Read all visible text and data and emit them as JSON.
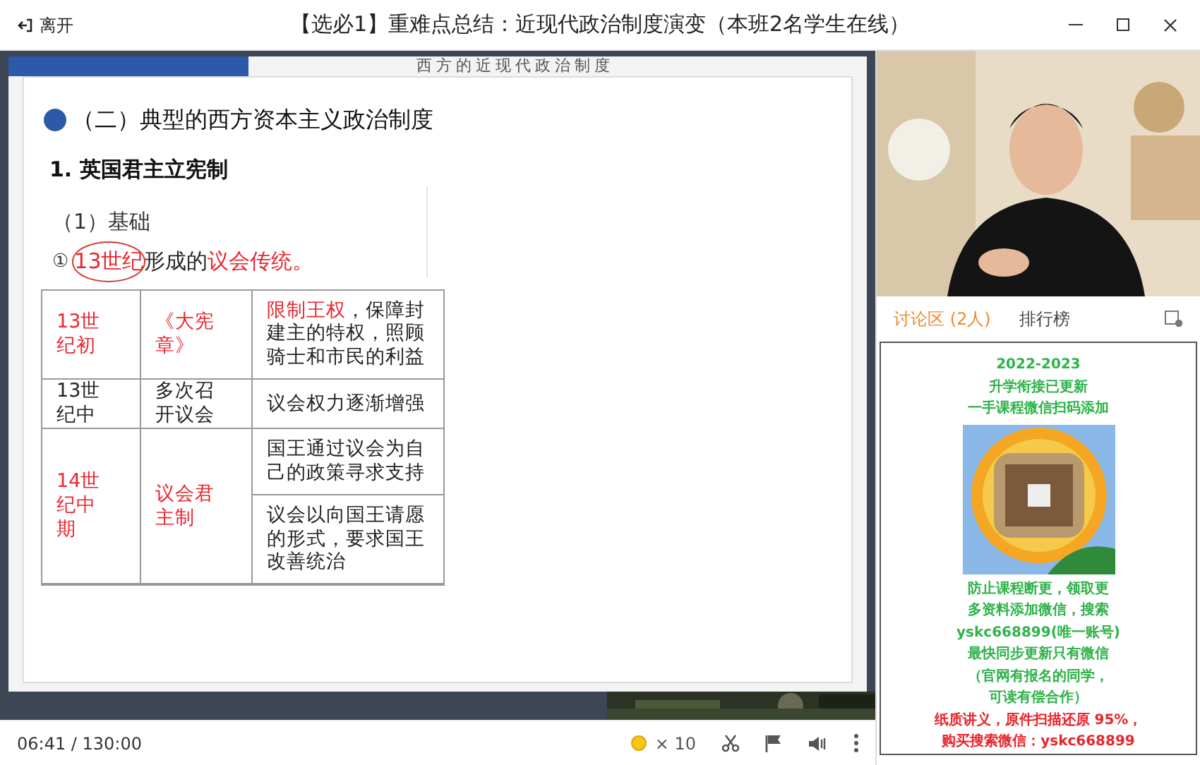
{
  "title_bar": {
    "leave": "离开",
    "title": "【选必1】重难点总结：近现代政治制度演变（本班2名学生在线）"
  },
  "slide": {
    "banner": "西方的近现代政治制度",
    "heading": "（二）典型的西方资本主义政治制度",
    "subheading": "1. 英国君主立宪制",
    "section": "（1）基础",
    "point": {
      "number": "①",
      "parts": [
        {
          "text": "13世纪",
          "red": true,
          "circled": true
        },
        {
          "text": "形成的",
          "red": false,
          "circled": false
        },
        {
          "text": "议会传统。",
          "red": true,
          "circled": false
        }
      ]
    },
    "table": [
      {
        "period": {
          "text": "13世纪初",
          "red": true
        },
        "event": {
          "text": "《大宪章》",
          "red": true
        },
        "effects": [
          [
            {
              "text": "限制王权",
              "red": true
            },
            {
              "text": "，保障封建主的特权，照顾骑士和市民的利益",
              "red": false
            }
          ]
        ]
      },
      {
        "period": {
          "text": "13世纪中",
          "red": false
        },
        "event": {
          "text": "多次召开议会",
          "red": false
        },
        "effects": [
          [
            {
              "text": "议会权力逐渐增强",
              "red": false
            }
          ]
        ]
      },
      {
        "period": {
          "text": "14世纪中期",
          "red": true
        },
        "event": {
          "text": "议会君主制",
          "red": true
        },
        "effects": [
          [
            {
              "text": "国王通过议会为自己的政策寻求支持",
              "red": false
            }
          ],
          [
            {
              "text": "议会以向国王请愿的形式，要求国王改善统治",
              "red": false
            }
          ]
        ]
      }
    ]
  },
  "player": {
    "time": "06:41 / 130:00",
    "coins": "× 10"
  },
  "tabs": [
    {
      "label": "讨论区 (2人)",
      "selected": true
    },
    {
      "label": "排行榜",
      "selected": false
    }
  ],
  "panel_lines_top": [
    {
      "text": "2022-2023",
      "color": "#2fb34a"
    },
    {
      "text": "升学衔接已更新",
      "color": "#2fb34a"
    },
    {
      "text": "一手课程微信扫码添加",
      "color": "#2fb34a"
    }
  ],
  "panel_lines_bottom": [
    {
      "text": "防止课程断更，领取更",
      "color": "#2fb34a"
    },
    {
      "text": "多资料添加微信，搜索",
      "color": "#2fb34a"
    },
    {
      "text": "yskc668899(唯一账号)",
      "color": "#2fb34a"
    },
    {
      "text": "最快同步更新只有微信",
      "color": "#2fb34a"
    },
    {
      "text": "（官网有报名的同学，",
      "color": "#2fb34a"
    },
    {
      "text": "可读有偿合作）",
      "color": "#2fb34a"
    },
    {
      "text": "纸质讲义，原件扫描还原 95%，",
      "color": "#e8262d"
    },
    {
      "text": "购买搜索微信：yskc668899",
      "color": "#e8262d"
    }
  ]
}
